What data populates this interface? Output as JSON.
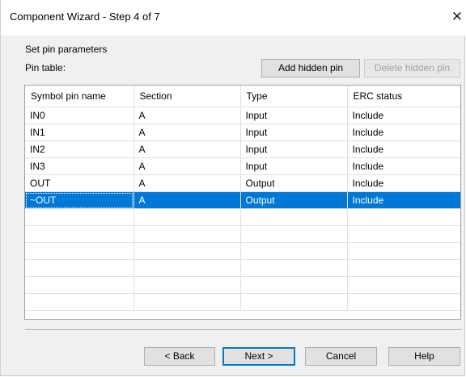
{
  "window": {
    "title": "Component Wizard - Step 4 of 7"
  },
  "heading": "Set pin parameters",
  "pin_table_label": "Pin table:",
  "buttons": {
    "add_hidden": "Add hidden pin",
    "delete_hidden": "Delete hidden pin",
    "back": "< Back",
    "next": "Next >",
    "cancel": "Cancel",
    "help": "Help"
  },
  "table": {
    "columns": [
      "Symbol pin name",
      "Section",
      "Type",
      "ERC status"
    ],
    "rows": [
      [
        "IN0",
        "A",
        "Input",
        "Include"
      ],
      [
        "IN1",
        "A",
        "Input",
        "Include"
      ],
      [
        "IN2",
        "A",
        "Input",
        "Include"
      ],
      [
        "IN3",
        "A",
        "Input",
        "Include"
      ],
      [
        "OUT",
        "A",
        "Output",
        "Include"
      ],
      [
        "~OUT",
        "A",
        "Output",
        "Include"
      ]
    ],
    "selected_row": 5
  },
  "colors": {
    "selection": "#0078d7"
  }
}
